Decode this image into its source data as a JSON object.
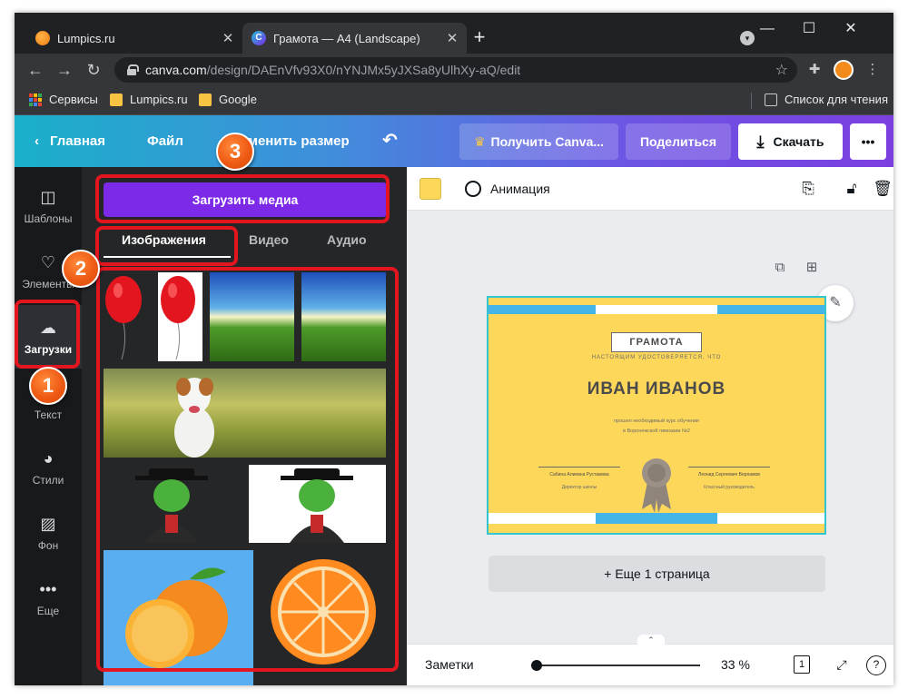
{
  "browser": {
    "tabs": [
      {
        "title": "Lumpics.ru",
        "close": "✕"
      },
      {
        "title": "Грамота — A4 (Landscape)",
        "close": "✕"
      }
    ],
    "new_tab": "+",
    "window_controls": {
      "minimize": "—",
      "maximize": "☐",
      "close": "✕"
    },
    "url_host": "canva.com",
    "url_path": "/design/DAEnVfv93X0/nYNJMx5yJXSa8yUlhXy-aQ/edit",
    "bookmarks": [
      {
        "label": "Сервисы"
      },
      {
        "label": "Lumpics.ru"
      },
      {
        "label": "Google"
      }
    ],
    "reading_list": "Список для чтения"
  },
  "canva_header": {
    "home": "Главная",
    "file": "Файл",
    "resize": "Изменить размер",
    "get_pro": "Получить Canva...",
    "share": "Поделиться",
    "download": "Скачать",
    "more": "•••"
  },
  "rail": {
    "items": [
      {
        "label": "Шаблоны",
        "icon": "templates-icon"
      },
      {
        "label": "Элементы",
        "icon": "elements-icon"
      },
      {
        "label": "Загрузки",
        "icon": "upload-cloud-icon"
      },
      {
        "label": "Текст",
        "icon": "text-icon"
      },
      {
        "label": "Стили",
        "icon": "palette-icon"
      },
      {
        "label": "Фон",
        "icon": "background-icon"
      },
      {
        "label": "Еще",
        "icon": "more-dots-icon"
      }
    ]
  },
  "panel": {
    "upload_button": "Загрузить медиа",
    "tabs": [
      "Изображения",
      "Видео",
      "Аудио"
    ],
    "active_tab": "Изображения"
  },
  "editor": {
    "animation": "Анимация",
    "swatch_color": "#fdd75a",
    "add_page": "+ Еще 1 страница",
    "notes": "Заметки",
    "zoom": "33 %",
    "page_count": "1",
    "help": "?"
  },
  "certificate": {
    "title": "ГРАМОТА",
    "subtitle": "НАСТОЯЩИМ УДОСТОВЕРЯЕТСЯ, ЧТО",
    "name": "ИВАН ИВАНОВ",
    "line1": "прошел необходимый курс обучения",
    "line2": "в Воронежской гимназии №2",
    "signer1_name": "Сабина Алиевна Рустамова",
    "signer1_role": "Директор школы",
    "signer2_name": "Леонид Сергеевич Верламов",
    "signer2_role": "Классный руководитель"
  },
  "annotations": {
    "step1": "1",
    "step2": "2",
    "step3": "3",
    "highlight_color": "#e3161f",
    "badge_color": "#ef5b14"
  }
}
